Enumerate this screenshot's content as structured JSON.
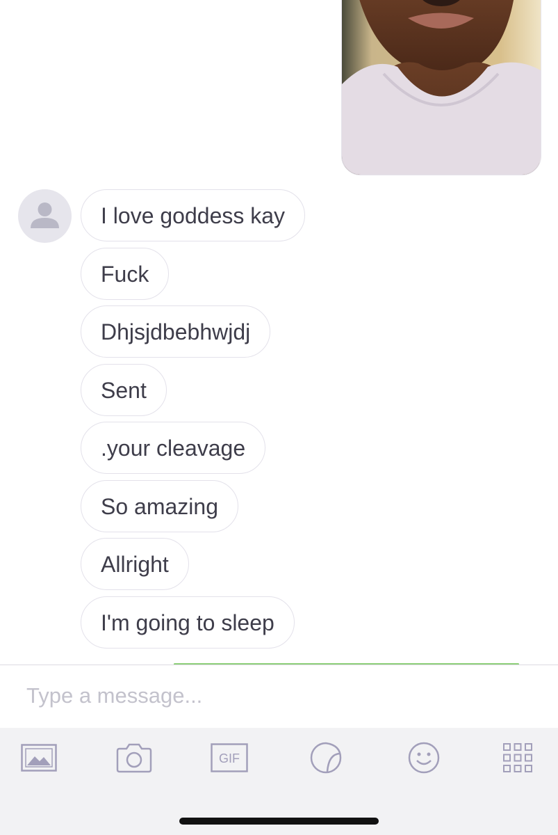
{
  "conversation": {
    "messages": [
      "I love goddess kay",
      "Fuck",
      "Dhjsjdbebhwjdj",
      "Sent",
      ".your cleavage",
      "So amazing",
      "Allright",
      "I'm going to sleep"
    ]
  },
  "composer": {
    "placeholder": "Type a message..."
  },
  "toolbar": {
    "gif_label": "GIF",
    "icons": [
      "photo-library-icon",
      "camera-icon",
      "gif-icon",
      "sticker-icon",
      "emoji-icon",
      "apps-grid-icon"
    ]
  },
  "colors": {
    "bubble_border": "#e3e1ea",
    "text": "#3e3d4a",
    "icon": "#a29fba",
    "toolbar_bg": "#f2f2f4",
    "accent_line": "#8fd07a"
  }
}
